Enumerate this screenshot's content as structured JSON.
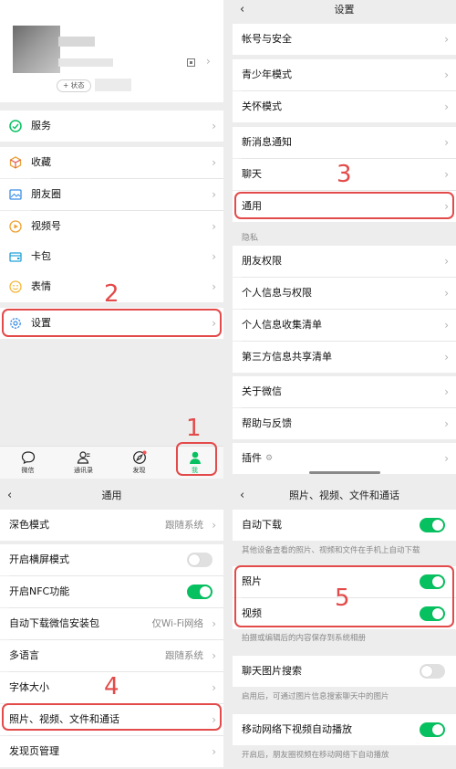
{
  "panel1": {
    "profile": {
      "status_label": "+ 状态",
      "chevron": "›"
    },
    "menu": [
      {
        "label": "服务",
        "icon": "service-icon"
      },
      {
        "label": "收藏",
        "icon": "favorites-icon"
      },
      {
        "label": "朋友圈",
        "icon": "moments-icon"
      },
      {
        "label": "视频号",
        "icon": "channels-icon"
      },
      {
        "label": "卡包",
        "icon": "card-wallet-icon"
      },
      {
        "label": "表情",
        "icon": "emoji-icon"
      },
      {
        "label": "设置",
        "icon": "settings-icon"
      }
    ],
    "tabs": [
      {
        "label": "微信",
        "icon": "chat-icon"
      },
      {
        "label": "通讯录",
        "icon": "contacts-icon"
      },
      {
        "label": "发现",
        "icon": "discover-icon"
      },
      {
        "label": "我",
        "icon": "me-icon"
      }
    ],
    "step_settings": "2",
    "step_me": "1"
  },
  "panel2": {
    "title": "设置",
    "back": "‹",
    "items": [
      "帐号与安全",
      "青少年模式",
      "关怀模式",
      "新消息通知",
      "聊天",
      "通用",
      "朋友权限",
      "个人信息与权限",
      "个人信息收集清单",
      "第三方信息共享清单",
      "关于微信",
      "帮助与反馈",
      "插件"
    ],
    "privacy_header": "隐私",
    "step": "3"
  },
  "panel3": {
    "title": "通用",
    "back": "‹",
    "dark_mode": {
      "label": "深色模式",
      "value": "跟随系统"
    },
    "landscape": {
      "label": "开启横屏模式",
      "on": false
    },
    "nfc": {
      "label": "开启NFC功能",
      "on": true
    },
    "auto_download": {
      "label": "自动下载微信安装包",
      "value": "仅Wi-Fi网络"
    },
    "language": {
      "label": "多语言",
      "value": "跟随系统"
    },
    "font_size": {
      "label": "字体大小"
    },
    "media": {
      "label": "照片、视频、文件和通话"
    },
    "discover_mgmt": {
      "label": "发现页管理"
    },
    "step": "4"
  },
  "panel4": {
    "title": "照片、视频、文件和通话",
    "back": "‹",
    "auto_download": {
      "label": "自动下载",
      "on": true,
      "hint": "其他设备查看的照片、视频和文件在手机上自动下载"
    },
    "photos": {
      "label": "照片",
      "on": true
    },
    "videos": {
      "label": "视频",
      "on": true
    },
    "save_hint": "拍摄或编辑后的内容保存到系统相册",
    "image_search": {
      "label": "聊天图片搜索",
      "on": false,
      "hint": "启用后，可通过图片信息搜索聊天中的图片"
    },
    "mobile_autoplay": {
      "label": "移动网络下视频自动播放",
      "on": true,
      "hint": "开启后，朋友圈视频在移动网络下自动播放"
    },
    "step": "5"
  }
}
